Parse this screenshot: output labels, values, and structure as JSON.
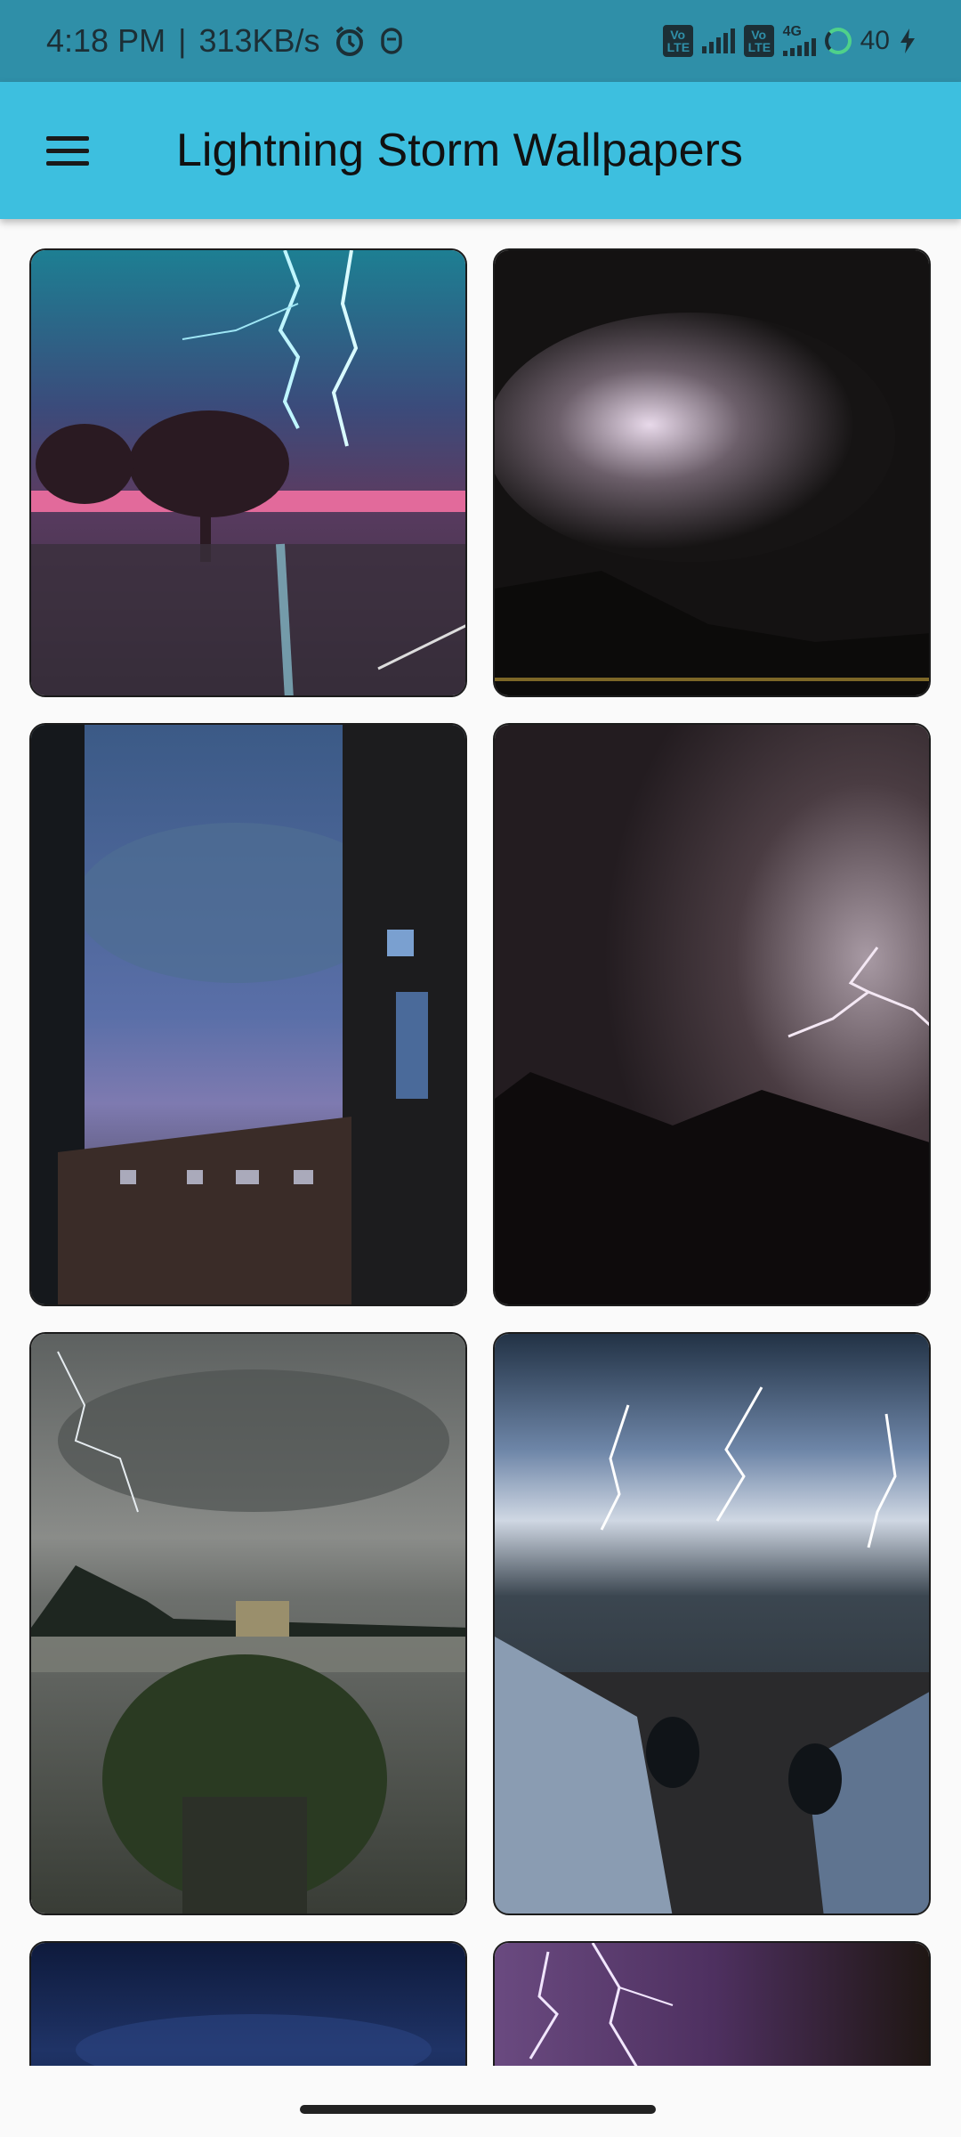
{
  "status_bar": {
    "time": "4:18 PM",
    "separator": "|",
    "speed": "313KB/s",
    "volte_1": "Vo LTE",
    "volte_2": "Vo LTE",
    "network": "4G",
    "battery": "40",
    "icons": [
      "alarm-icon",
      "notification-icon",
      "signal-icon",
      "signal-icon",
      "battery-icon",
      "charging-icon"
    ]
  },
  "app_bar": {
    "title": "Lightning Storm Wallpapers",
    "menu_icon": "hamburger-menu-icon"
  },
  "wallpapers": [
    {
      "id": "1",
      "subject": "city-lightning"
    },
    {
      "id": "2",
      "subject": "cloud-lightning"
    },
    {
      "id": "3",
      "subject": "window-storm"
    },
    {
      "id": "4",
      "subject": "rooftop-lightning"
    },
    {
      "id": "5",
      "subject": "lake-lightning"
    },
    {
      "id": "6",
      "subject": "sea-lightning"
    },
    {
      "id": "7",
      "subject": "blue-night"
    },
    {
      "id": "8",
      "subject": "purple-lightning"
    }
  ],
  "colors": {
    "status_bar": "#2f8fa8",
    "app_bar": "#3dbfdf",
    "background": "#fafafa"
  }
}
